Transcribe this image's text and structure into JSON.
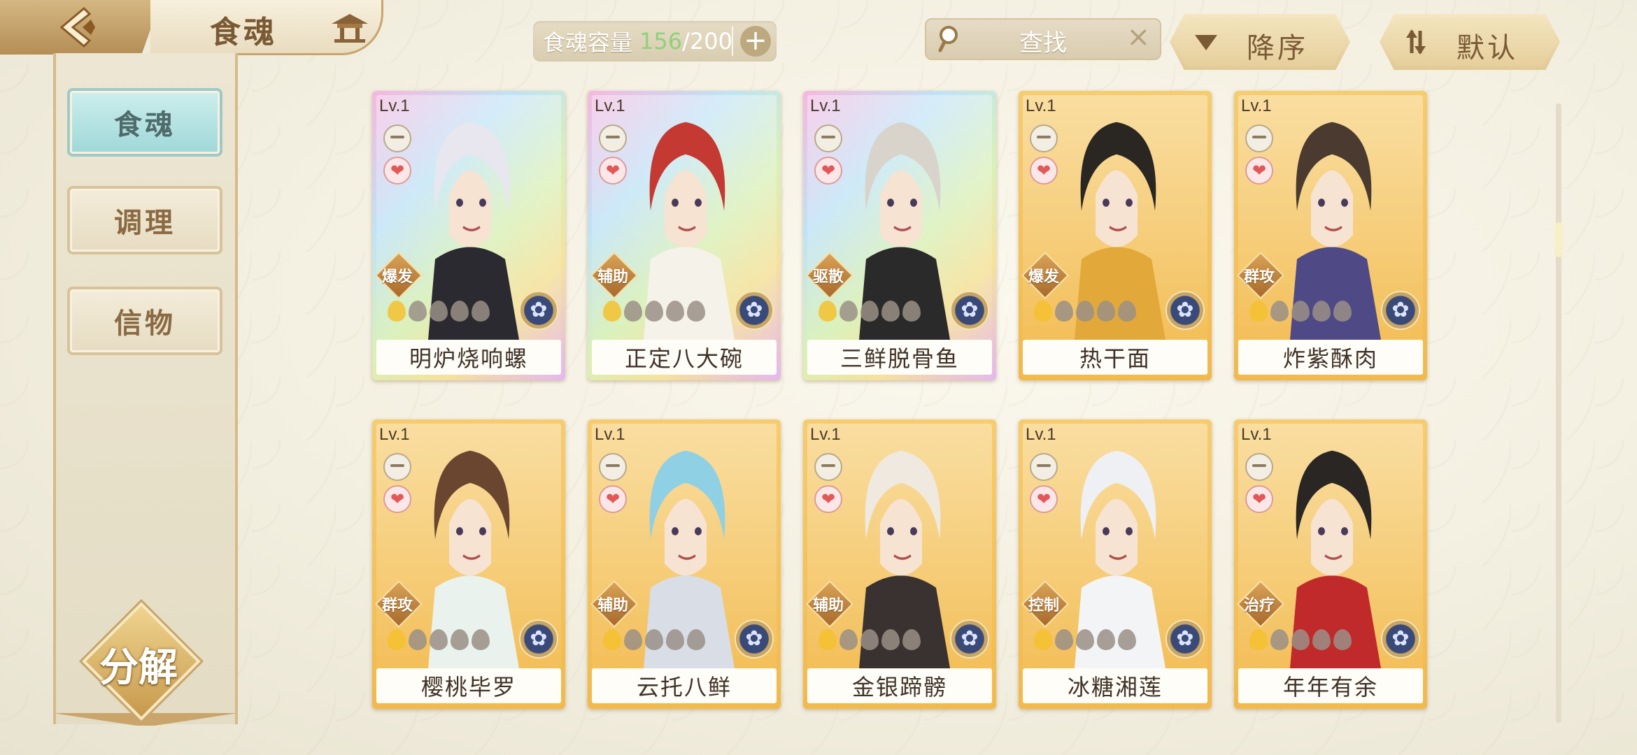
{
  "header": {
    "title": "食魂",
    "capacity": {
      "label": "食魂容量",
      "current": "156",
      "separator": "/",
      "max": "200",
      "add": "+"
    },
    "search": {
      "placeholder": "查找",
      "clear": "×"
    },
    "sort_button": "降序",
    "filter_button": "默认"
  },
  "sidebar": {
    "tabs": [
      {
        "label": "食魂",
        "active": true
      },
      {
        "label": "调理",
        "active": false
      },
      {
        "label": "信物",
        "active": false
      }
    ],
    "decompose_label": "分解"
  },
  "cards": [
    {
      "level": "Lv.1",
      "name": "明炉烧响螺",
      "role": "爆发",
      "rarity": "rainbow",
      "stars_on": 1
    },
    {
      "level": "Lv.1",
      "name": "正定八大碗",
      "role": "辅助",
      "rarity": "rainbow",
      "stars_on": 1
    },
    {
      "level": "Lv.1",
      "name": "三鲜脱骨鱼",
      "role": "驱散",
      "rarity": "rainbow",
      "stars_on": 1
    },
    {
      "level": "Lv.1",
      "name": "热干面",
      "role": "爆发",
      "rarity": "gold",
      "stars_on": 1
    },
    {
      "level": "Lv.1",
      "name": "炸紫酥肉",
      "role": "群攻",
      "rarity": "gold",
      "stars_on": 1
    },
    {
      "level": "Lv.1",
      "name": "樱桃毕罗",
      "role": "群攻",
      "rarity": "gold",
      "stars_on": 1
    },
    {
      "level": "Lv.1",
      "name": "云托八鲜",
      "role": "辅助",
      "rarity": "gold",
      "stars_on": 1
    },
    {
      "level": "Lv.1",
      "name": "金银蹄髈",
      "role": "辅助",
      "rarity": "gold",
      "stars_on": 1
    },
    {
      "level": "Lv.1",
      "name": "冰糖湘莲",
      "role": "控制",
      "rarity": "gold",
      "stars_on": 1
    },
    {
      "level": "Lv.1",
      "name": "年年有余",
      "role": "治疗",
      "rarity": "gold",
      "stars_on": 1
    }
  ],
  "colors": {
    "capacity_current": "#8fd17a",
    "active_tab": "#9fd8d8",
    "card_gold": "#f2b94c",
    "brand_brown": "#7a5a34"
  },
  "icons": [
    "back-arrow-icon",
    "home-pavilion-icon",
    "search-icon",
    "close-icon",
    "sort-desc-icon",
    "filter-icon",
    "bowl-icon",
    "heart-icon",
    "element-icon"
  ]
}
